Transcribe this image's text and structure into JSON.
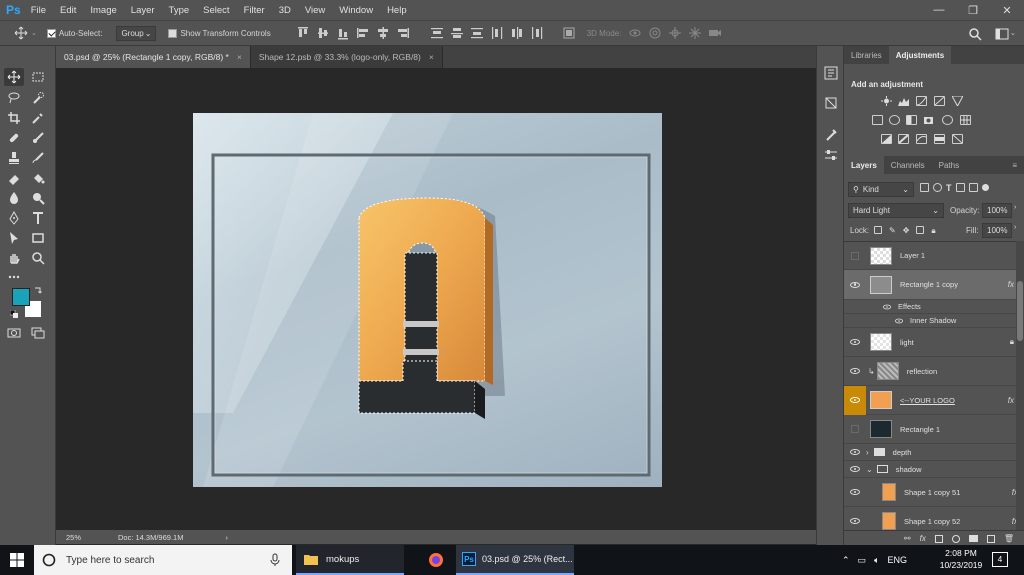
{
  "app": {
    "logo": "Ps",
    "accent": "#31a8ff"
  },
  "menu": [
    "File",
    "Edit",
    "Image",
    "Layer",
    "Type",
    "Select",
    "Filter",
    "3D",
    "View",
    "Window",
    "Help"
  ],
  "window_controls": {
    "minimize": "—",
    "restore": "❐",
    "close": "✕"
  },
  "options": {
    "auto_select_label": "Auto-Select:",
    "auto_select_value": "Group",
    "transform_label": "Show Transform Controls",
    "mode_3d_label": "3D Mode:"
  },
  "doc_tabs": [
    {
      "label": "03.psd @ 25% (Rectangle 1 copy, RGB/8) *",
      "close": "×"
    },
    {
      "label": "Shape 12.psb @ 33.3% (logo-only, RGB/8)",
      "close": "×"
    }
  ],
  "status": {
    "zoom": "25%",
    "doc": "Doc: 14.3M/969.1M",
    "arrow": "›"
  },
  "panels": {
    "top_tabs": [
      "Libraries",
      "Adjustments"
    ],
    "adjustments_title": "Add an adjustment",
    "layer_tabs": [
      "Layers",
      "Channels",
      "Paths"
    ],
    "kind_label": "Kind",
    "blend_mode": "Hard Light",
    "opacity_label": "Opacity:",
    "opacity_value": "100%",
    "lock_label": "Lock:",
    "fill_label": "Fill:",
    "fill_value": "100%",
    "layers": [
      {
        "name": "Layer 1",
        "visible": false
      },
      {
        "name": "Rectangle 1 copy",
        "visible": true,
        "fx": "fx"
      },
      {
        "name": "Effects",
        "visible": true
      },
      {
        "name": "Inner Shadow",
        "visible": true
      },
      {
        "name": "light",
        "visible": true
      },
      {
        "name": "reflection",
        "visible": true
      },
      {
        "name": "<--YOUR LOGO",
        "visible": true,
        "fx": "fx"
      },
      {
        "name": "Rectangle 1",
        "visible": false
      },
      {
        "name": "depth",
        "visible": true
      },
      {
        "name": "shadow",
        "visible": true
      },
      {
        "name": "Shape 1 copy 51",
        "visible": true,
        "fx": "fx"
      },
      {
        "name": "Shape 1 copy 52",
        "visible": true,
        "fx": "fx"
      }
    ],
    "bottom_icons": [
      "link-icon",
      "fx-icon",
      "mask-icon",
      "adjustment-icon",
      "folder-icon",
      "new-layer-icon",
      "trash-icon"
    ]
  },
  "taskbar": {
    "search_placeholder": "Type here to search",
    "folder_label": "mokups",
    "ps_label": "03.psd @ 25% (Rect...",
    "lang": "ENG",
    "time": "2:08 PM",
    "date": "10/23/2019",
    "notifications": "4"
  },
  "colors": {
    "foreground": "#1aa3b8",
    "background": "#ffffff"
  }
}
